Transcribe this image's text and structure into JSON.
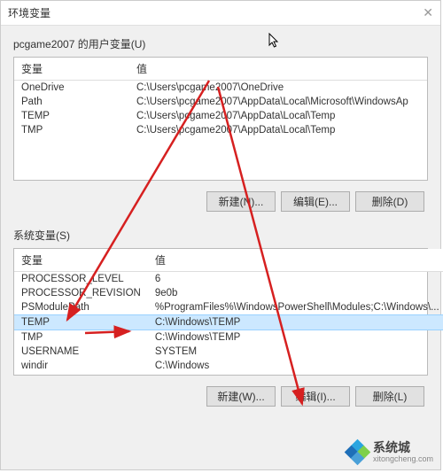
{
  "window": {
    "title": "环境变量"
  },
  "user_section": {
    "label": "pcgame2007 的用户变量(U)",
    "columns": {
      "name": "变量",
      "value": "值"
    },
    "rows": [
      {
        "name": "OneDrive",
        "value": "C:\\Users\\pcgame2007\\OneDrive"
      },
      {
        "name": "Path",
        "value": "C:\\Users\\pcgame2007\\AppData\\Local\\Microsoft\\WindowsAp"
      },
      {
        "name": "TEMP",
        "value": "C:\\Users\\pcgame2007\\AppData\\Local\\Temp"
      },
      {
        "name": "TMP",
        "value": "C:\\Users\\pcgame2007\\AppData\\Local\\Temp"
      }
    ],
    "buttons": {
      "new": "新建(N)...",
      "edit": "编辑(E)...",
      "delete": "删除(D)"
    }
  },
  "system_section": {
    "label": "系统变量(S)",
    "columns": {
      "name": "变量",
      "value": "值"
    },
    "rows": [
      {
        "name": "PROCESSOR_LEVEL",
        "value": "6"
      },
      {
        "name": "PROCESSOR_REVISION",
        "value": "9e0b"
      },
      {
        "name": "PSModulePath",
        "value": "%ProgramFiles%\\WindowsPowerShell\\Modules;C:\\Windows\\..."
      },
      {
        "name": "TEMP",
        "value": "C:\\Windows\\TEMP"
      },
      {
        "name": "TMP",
        "value": "C:\\Windows\\TEMP"
      },
      {
        "name": "USERNAME",
        "value": "SYSTEM"
      },
      {
        "name": "windir",
        "value": "C:\\Windows"
      }
    ],
    "selected_index": 3,
    "buttons": {
      "new": "新建(W)...",
      "edit": "编辑(I)...",
      "delete": "删除(L)"
    }
  },
  "watermark": {
    "cn": "系统城",
    "en": "xitongcheng.com"
  },
  "annotation_color": "#d62020"
}
